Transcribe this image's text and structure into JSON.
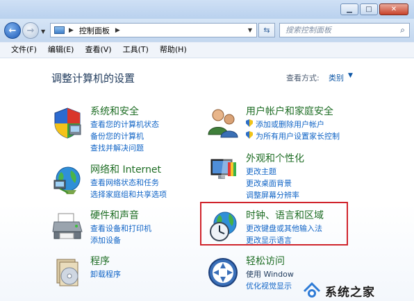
{
  "window": {
    "buttons": {
      "minimize": "▁",
      "maximize": "□",
      "close": "✕"
    }
  },
  "address": {
    "location": "控制面板",
    "search_placeholder": "搜索控制面板"
  },
  "menu": [
    "文件(F)",
    "编辑(E)",
    "查看(V)",
    "工具(T)",
    "帮助(H)"
  ],
  "page": {
    "title": "调整计算机的设置",
    "view_by_label": "查看方式:",
    "view_by_value": "类别"
  },
  "categories": {
    "system": {
      "title": "系统和安全",
      "links": [
        "查看您的计算机状态",
        "备份您的计算机",
        "查找并解决问题"
      ]
    },
    "network": {
      "title": "网络和 Internet",
      "links": [
        "查看网络状态和任务",
        "选择家庭组和共享选项"
      ]
    },
    "hardware": {
      "title": "硬件和声音",
      "links": [
        "查看设备和打印机",
        "添加设备"
      ]
    },
    "programs": {
      "title": "程序",
      "links": [
        "卸载程序"
      ]
    },
    "users": {
      "title": "用户帐户和家庭安全",
      "links": [
        "添加或删除用户帐户",
        "为所有用户设置家长控制"
      ]
    },
    "appearance": {
      "title": "外观和个性化",
      "links": [
        "更改主题",
        "更改桌面背景",
        "调整屏幕分辨率"
      ]
    },
    "clock": {
      "title": "时钟、语言和区域",
      "links": [
        "更改键盘或其他输入法",
        "更改显示语言"
      ]
    },
    "ease": {
      "title": "轻松访问",
      "links": [
        "使用 Window",
        "优化视觉显示"
      ]
    }
  },
  "watermark": {
    "text": "系统之家"
  },
  "colors": {
    "category_title": "#1e6d24",
    "link": "#1064c6",
    "highlight": "#d0232b"
  }
}
